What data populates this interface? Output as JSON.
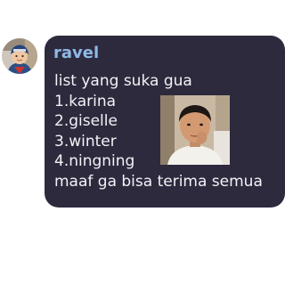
{
  "message": {
    "username": "ravel",
    "lines": [
      "list yang suka gua",
      "1.karina",
      "2.giselle",
      "3.winter",
      "4.ningning",
      "maaf ga bisa terima semua"
    ]
  },
  "colors": {
    "bubble_background": "#2d2a3e",
    "username": "#8fb9e6",
    "message_text": "#f2f2f5",
    "page_background": "#ffffff"
  },
  "icons": {
    "avatar": "user-avatar-image",
    "attachment": "child-photo-image"
  }
}
